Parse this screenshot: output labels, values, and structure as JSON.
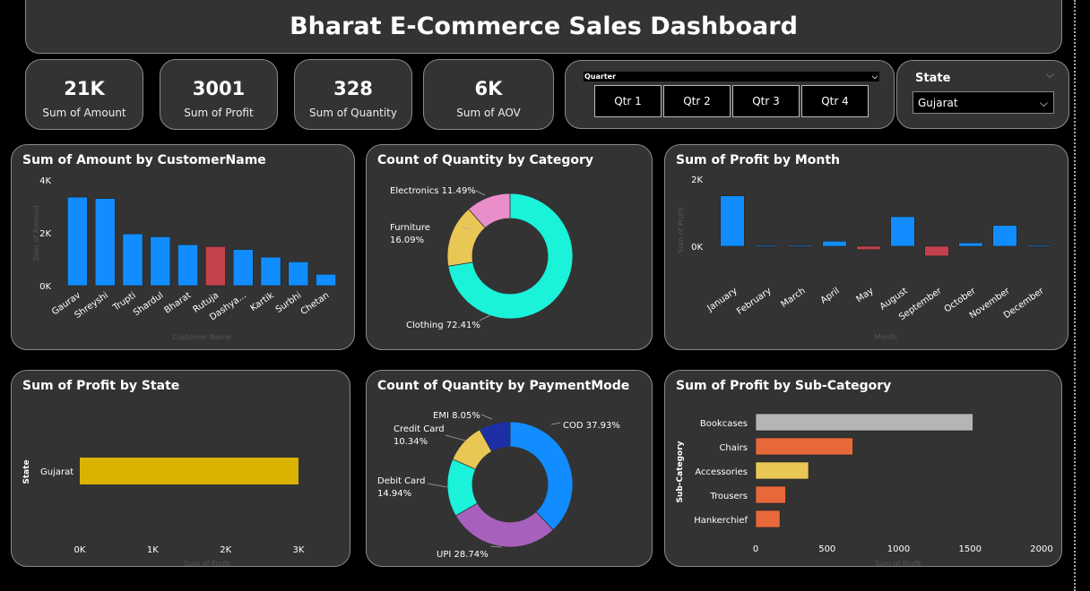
{
  "header": {
    "title": "Bharat E-Commerce Sales Dashboard"
  },
  "kpis": [
    {
      "value": "21K",
      "label": "Sum of Amount"
    },
    {
      "value": "3001",
      "label": "Sum of Profit"
    },
    {
      "value": "328",
      "label": "Sum of Quantity"
    },
    {
      "value": "6K",
      "label": "Sum of AOV"
    }
  ],
  "quarter_slicer": {
    "label": "Quarter",
    "options": [
      "Qtr 1",
      "Qtr 2",
      "Qtr 3",
      "Qtr 4"
    ]
  },
  "state_slicer": {
    "label": "State",
    "selected": "Gujarat"
  },
  "colors": {
    "blue": "#118dff",
    "red": "#c4424d",
    "teal": "#1af2d9",
    "yellow": "#e8c755",
    "pink": "#e98ec8",
    "purple": "#a761bd",
    "navy": "#1e2fa6",
    "gold": "#d9b300",
    "grey": "#b5b5b5",
    "orange": "#e8683a"
  },
  "chart_data": [
    {
      "id": "amount_by_customer",
      "type": "bar",
      "title": "Sum of Amount by CustomerName",
      "xlabel": "Customer Name",
      "ylabel": "Sum of Amount",
      "yticks": [
        "0K",
        "2K",
        "4K"
      ],
      "ylim": [
        0,
        4000
      ],
      "categories": [
        "Gaurav",
        "Shreyshi",
        "Trupti",
        "Shardul",
        "Bharat",
        "Rutuja",
        "Dashya...",
        "Kartik",
        "Surbhi",
        "Chetan"
      ],
      "values": [
        3350,
        3300,
        1960,
        1850,
        1550,
        1480,
        1370,
        1080,
        900,
        430
      ],
      "highlight_index": 5
    },
    {
      "id": "quantity_by_category",
      "type": "pie",
      "title": "Count of Quantity by Category",
      "labels": [
        "Clothing",
        "Furniture",
        "Electronics"
      ],
      "values": [
        72.41,
        16.09,
        11.49
      ],
      "display": [
        "Clothing 72.41%",
        "Furniture\n16.09%",
        "Electronics 11.49%"
      ]
    },
    {
      "id": "profit_by_month",
      "type": "bar",
      "title": "Sum of Profit by Month",
      "xlabel": "Month",
      "ylabel": "Sum of Profit",
      "yticks": [
        "0K",
        "2K"
      ],
      "ylim": [
        -400,
        2000
      ],
      "categories": [
        "January",
        "February",
        "March",
        "April",
        "May",
        "August",
        "September",
        "October",
        "November",
        "December"
      ],
      "values": [
        1500,
        10,
        10,
        150,
        -100,
        880,
        -290,
        100,
        620,
        10
      ]
    },
    {
      "id": "profit_by_state",
      "type": "bar",
      "orientation": "horizontal",
      "title": "Sum of Profit by State",
      "xlabel": "Sum of Profit",
      "ylabel": "State",
      "xticks": [
        "0K",
        "1K",
        "2K",
        "3K"
      ],
      "xlim": [
        0,
        3000
      ],
      "categories": [
        "Gujarat"
      ],
      "values": [
        3001
      ]
    },
    {
      "id": "quantity_by_payment",
      "type": "pie",
      "title": "Count of Quantity by PaymentMode",
      "labels": [
        "COD",
        "UPI",
        "Debit Card",
        "Credit Card",
        "EMI"
      ],
      "values": [
        37.93,
        28.74,
        14.94,
        10.34,
        8.05
      ],
      "display": [
        "COD 37.93%",
        "UPI 28.74%",
        "Debit Card\n14.94%",
        "Credit Card\n10.34%",
        "EMI 8.05%"
      ]
    },
    {
      "id": "profit_by_subcategory",
      "type": "bar",
      "orientation": "horizontal",
      "title": "Sum of Profit by Sub-Category",
      "xlabel": "Sum of Profit",
      "ylabel": "Sub-Category",
      "xticks": [
        "0",
        "500",
        "1000",
        "1500",
        "2000"
      ],
      "xlim": [
        0,
        2000
      ],
      "categories": [
        "Bookcases",
        "Chairs",
        "Accessories",
        "Trousers",
        "Hankerchief"
      ],
      "values": [
        1520,
        680,
        370,
        210,
        170
      ]
    }
  ]
}
